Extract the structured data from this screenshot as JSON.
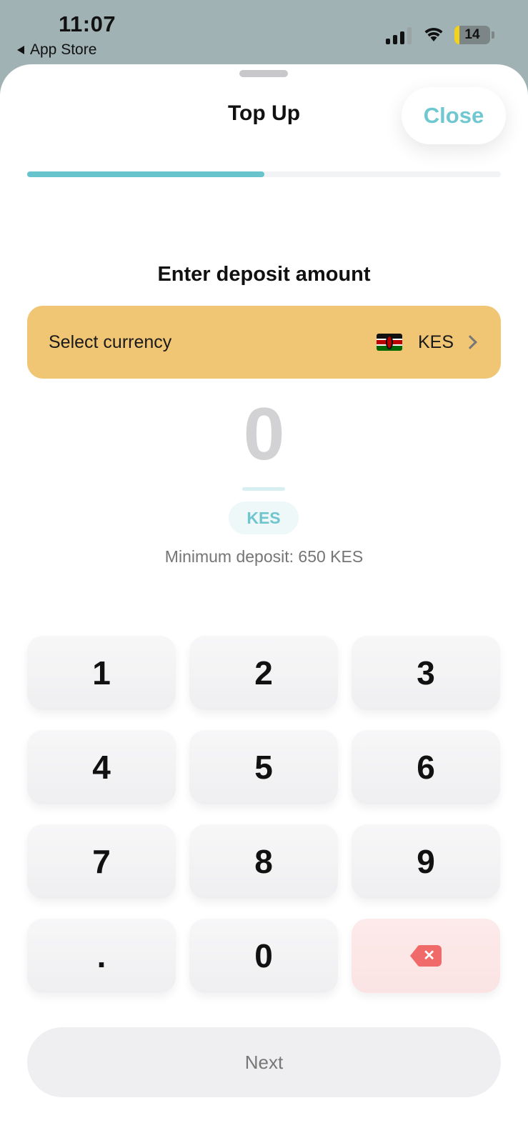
{
  "status_bar": {
    "time": "11:07",
    "back_label": "App Store",
    "battery": "14"
  },
  "sheet": {
    "title": "Top Up",
    "close_label": "Close",
    "progress": 0.5
  },
  "deposit": {
    "prompt": "Enter deposit amount",
    "select_currency_label": "Select currency",
    "currency_code": "KES",
    "amount": "0",
    "currency_chip": "KES",
    "minimum_text": "Minimum deposit: 650 KES"
  },
  "keypad": {
    "keys": [
      "1",
      "2",
      "3",
      "4",
      "5",
      "6",
      "7",
      "8",
      "9",
      ".",
      "0"
    ],
    "delete_icon": "backspace-icon"
  },
  "next_label": "Next",
  "colors": {
    "accent": "#67c3cc",
    "currency_row": "#f0c674",
    "delete_key": "#fbe3e3"
  }
}
